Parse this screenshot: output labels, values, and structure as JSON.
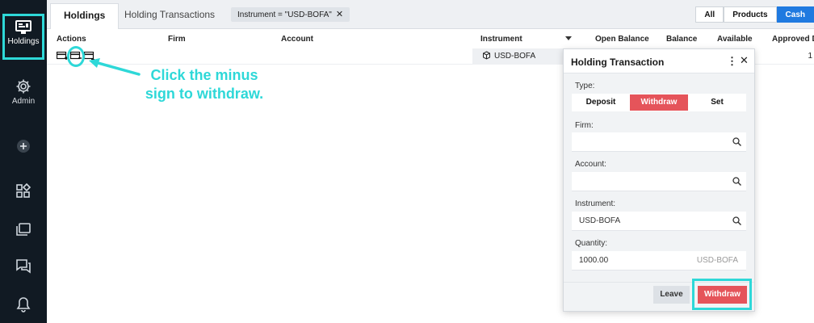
{
  "sidebar": {
    "items": [
      {
        "name": "holdings",
        "label": "Holdings",
        "icon": "holdings-monitor-icon",
        "active": true
      },
      {
        "name": "admin",
        "label": "Admin",
        "icon": "gear-icon"
      },
      {
        "name": "add",
        "label": "",
        "icon": "plus-circle-icon"
      },
      {
        "name": "apps",
        "label": "",
        "icon": "widgets-icon"
      },
      {
        "name": "windows",
        "label": "",
        "icon": "windows-icon"
      },
      {
        "name": "chat",
        "label": "",
        "icon": "chat-icon"
      },
      {
        "name": "notifications",
        "label": "",
        "icon": "bell-icon"
      }
    ]
  },
  "tabs": {
    "holdings": "Holdings",
    "holding_transactions": "Holding Transactions",
    "filter_chip": "Instrument = \"USD-BOFA\"",
    "filter_close": "✕"
  },
  "toggles": {
    "all": "All",
    "products": "Products",
    "cash": "Cash"
  },
  "table": {
    "columns": {
      "actions": "Actions",
      "firm": "Firm",
      "account": "Account",
      "instrument": "Instrument",
      "open_balance": "Open Balance",
      "balance": "Balance",
      "available": "Available",
      "approved": "Approved De"
    },
    "row": {
      "instrument": "USD-BOFA",
      "approved": "1"
    }
  },
  "annotation": {
    "text": "Click the minus sign to withdraw."
  },
  "dialog": {
    "title": "Holding Transaction",
    "more": "⋮",
    "close": "✕",
    "type_label": "Type:",
    "type_options": {
      "deposit": "Deposit",
      "withdraw": "Withdraw",
      "set": "Set"
    },
    "firm_label": "Firm:",
    "firm_value": "",
    "account_label": "Account:",
    "account_value": "",
    "instrument_label": "Instrument:",
    "instrument_value": "USD-BOFA",
    "quantity_label": "Quantity:",
    "quantity_value": "1000.00",
    "quantity_unit": "USD-BOFA",
    "leave_button": "Leave",
    "withdraw_button": "Withdraw"
  },
  "colors": {
    "accent": "#2ed8d8",
    "danger": "#e5545a",
    "primary": "#1f7ae0",
    "sidebar": "#111a23"
  }
}
